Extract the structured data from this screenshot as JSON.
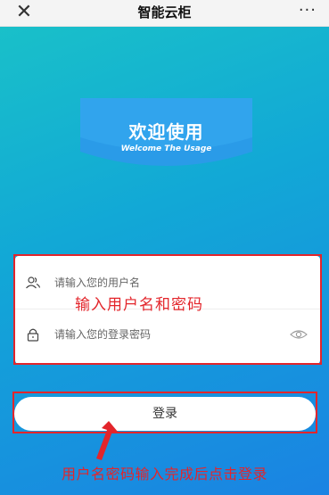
{
  "header": {
    "title": "智能云柜",
    "close_icon": "close-icon",
    "more_label": "···"
  },
  "banner": {
    "title_cn": "欢迎使用",
    "title_en": "Welcome The Usage"
  },
  "login_form": {
    "username": {
      "placeholder": "请输入您的用户名",
      "icon": "user-icon"
    },
    "password": {
      "placeholder": "请输入您的登录密码",
      "icon": "lock-icon",
      "toggle_icon": "eye-icon"
    },
    "submit_label": "登录"
  },
  "annotations": {
    "form_hint": "输入用户名和密码",
    "button_hint": "用户名密码输入完成后点击登录"
  },
  "colors": {
    "background_start": "#19c0c9",
    "background_end": "#1a83e3",
    "annotation_red": "#e3252b"
  }
}
